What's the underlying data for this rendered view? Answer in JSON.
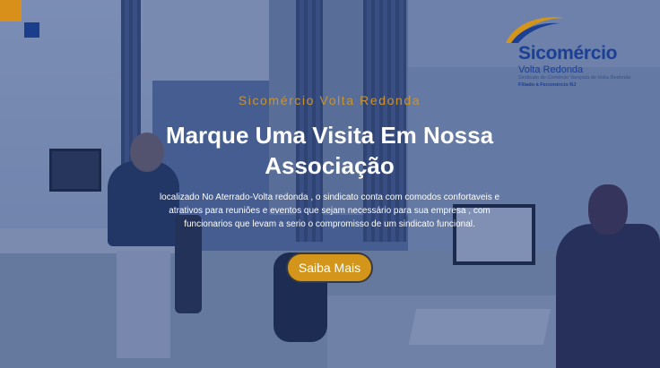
{
  "colors": {
    "accent": "#d4961a",
    "brand_blue": "#1b3f93",
    "overlay": "#223c7d"
  },
  "logo": {
    "name": "Sicomércio",
    "city": "Volta Redonda",
    "subtitle": "Sindicato do Comércio Varejista de Volta Redonda",
    "federation": "Filiado à Fecomércio RJ",
    "icon": "swoosh-icon"
  },
  "hero": {
    "eyebrow": "Sicomércio Volta Redonda",
    "title": "Marque Uma Visita Em Nossa Associação",
    "description": "localizado No Aterrado-Volta redonda , o sindicato conta com comodos confortaveis e atrativos para reuniões e eventos que sejam necessário para sua empresa , com funcionarios que levam a serio o compromisso de um sindicato funcional.",
    "cta_label": "Saiba Mais"
  }
}
